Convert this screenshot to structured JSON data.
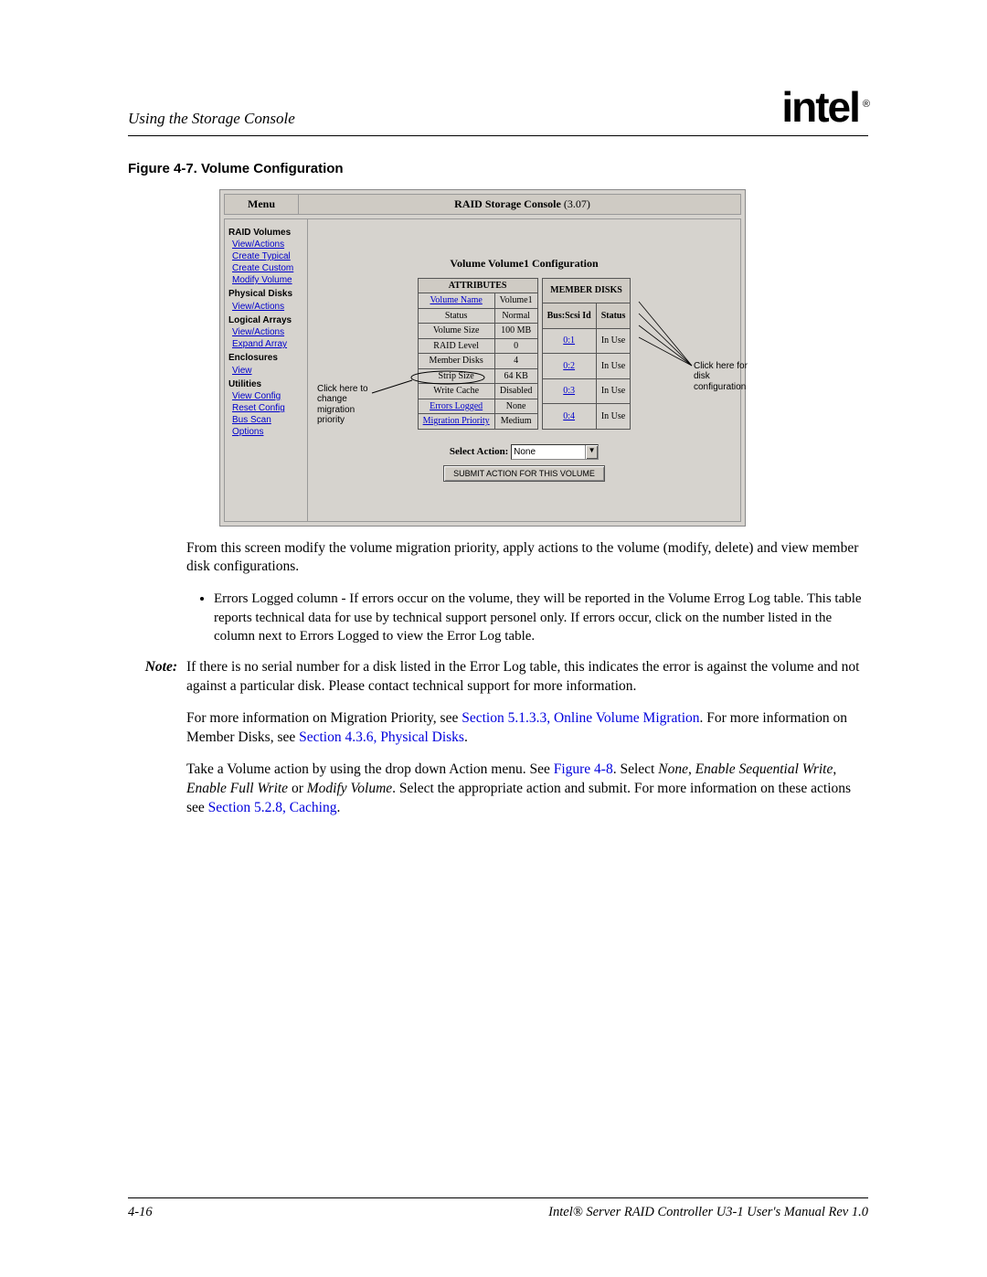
{
  "header": {
    "section_title": "Using the Storage Console",
    "brand": "intel",
    "reg": "®"
  },
  "figure": {
    "caption": "Figure 4-7. Volume Configuration",
    "console_title_bold": "RAID Storage Console",
    "console_title_ver": "(3.07)",
    "menu_label": "Menu",
    "menu_sections": [
      {
        "head": "RAID Volumes",
        "items": [
          "View/Actions",
          "Create Typical",
          "Create Custom",
          "Modify Volume"
        ]
      },
      {
        "head": "Physical Disks",
        "items": [
          "View/Actions"
        ]
      },
      {
        "head": "Logical Arrays",
        "items": [
          "View/Actions",
          "Expand Array"
        ]
      },
      {
        "head": "Enclosures",
        "items": [
          "View"
        ]
      },
      {
        "head": "Utilities",
        "items": [
          "View Config",
          "Reset Config",
          "Bus Scan",
          "Options"
        ]
      }
    ],
    "vc_title": "Volume Volume1 Configuration",
    "attributes": {
      "header": "ATTRIBUTES",
      "rows": [
        {
          "label": "Volume Name",
          "value": "Volume1",
          "link": true
        },
        {
          "label": "Status",
          "value": "Normal"
        },
        {
          "label": "Volume Size",
          "value": "100 MB"
        },
        {
          "label": "RAID Level",
          "value": "0"
        },
        {
          "label": "Member Disks",
          "value": "4"
        },
        {
          "label": "Strip Size",
          "value": "64 KB"
        },
        {
          "label": "Write Cache",
          "value": "Disabled"
        },
        {
          "label": "Errors Logged",
          "value": "None",
          "link": true
        },
        {
          "label": "Migration Priority",
          "value": "Medium",
          "link": true,
          "circled": true
        }
      ]
    },
    "member_disks": {
      "header": "MEMBER DISKS",
      "cols": [
        "Bus:Scsi Id",
        "Status"
      ],
      "rows": [
        {
          "id": "0:1",
          "status": "In Use"
        },
        {
          "id": "0:2",
          "status": "In Use"
        },
        {
          "id": "0:3",
          "status": "In Use"
        },
        {
          "id": "0:4",
          "status": "In Use"
        }
      ]
    },
    "select_action_label": "Select Action:",
    "select_action_value": "None",
    "submit_label": "SUBMIT ACTION FOR THIS VOLUME",
    "annotation_left": "Click here to change migration priority",
    "annotation_right": "Click here for disk configuration"
  },
  "body": {
    "para1": "From this screen modify the volume migration priority, apply actions to the volume (modify, delete) and view member disk configurations.",
    "bullet1": "Errors Logged column - If errors occur on the volume, they will be reported in the Volume Errog Log table. This table reports technical data for use by technical support personel only. If errors occur, click on the number listed in the column next to Errors Logged to view the Error Log table.",
    "note_label": "Note:",
    "note_text": "If there is no serial number for a disk listed in the Error Log table, this indicates the error is against the volume and not against a particular disk. Please contact technical support for more information.",
    "para2_pre": "For more information on Migration Priority, see ",
    "para2_link1": "Section 5.1.3.3, Online Volume Migration",
    "para2_mid": ". For more information on Member Disks, see ",
    "para2_link2": "Section 4.3.6, Physical Disks",
    "para2_end": ".",
    "para3_pre": "Take a Volume action by using the drop down Action menu. See ",
    "para3_link1": "Figure 4-8",
    "para3_mid1": ". Select ",
    "para3_em1": "None",
    "para3_mid2": ", ",
    "para3_em2": "Enable Sequential Write",
    "para3_mid3": ", ",
    "para3_em3": "Enable Full Write",
    "para3_mid4": " or ",
    "para3_em4": "Modify Volume",
    "para3_mid5": ". Select the appropriate action and submit. For more information on these actions see ",
    "para3_link2": "Section 5.2.8, Caching",
    "para3_end": "."
  },
  "footer": {
    "page": "4-16",
    "doc": "Intel® Server RAID Controller U3-1 User's Manual Rev 1.0"
  }
}
